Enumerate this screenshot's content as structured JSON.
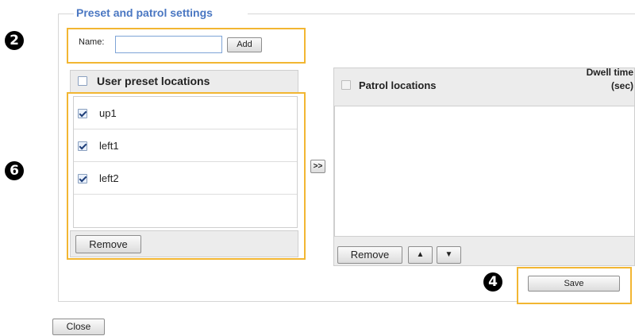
{
  "fieldset": {
    "legend": "Preset and patrol settings"
  },
  "callouts": {
    "name_box": "2",
    "preset_box": "6",
    "save_box": "4"
  },
  "name_field": {
    "label": "Name:",
    "value": "",
    "add_label": "Add"
  },
  "preset_list": {
    "header": "User preset locations",
    "header_checked": false,
    "items": [
      {
        "label": "up1",
        "checked": true
      },
      {
        "label": "left1",
        "checked": true
      },
      {
        "label": "left2",
        "checked": true
      }
    ],
    "remove_label": "Remove"
  },
  "transfer_button": {
    "label": ">>"
  },
  "patrol_list": {
    "header": "Patrol locations",
    "dwell_header_line1": "Dwell time",
    "dwell_header_line2": "(sec)",
    "remove_label": "Remove",
    "up_label": "▲",
    "down_label": "▼"
  },
  "save_label": "Save",
  "close_label": "Close",
  "colors": {
    "highlight": "#f2b632",
    "legend": "#4a77c2",
    "badge": "#000000"
  }
}
